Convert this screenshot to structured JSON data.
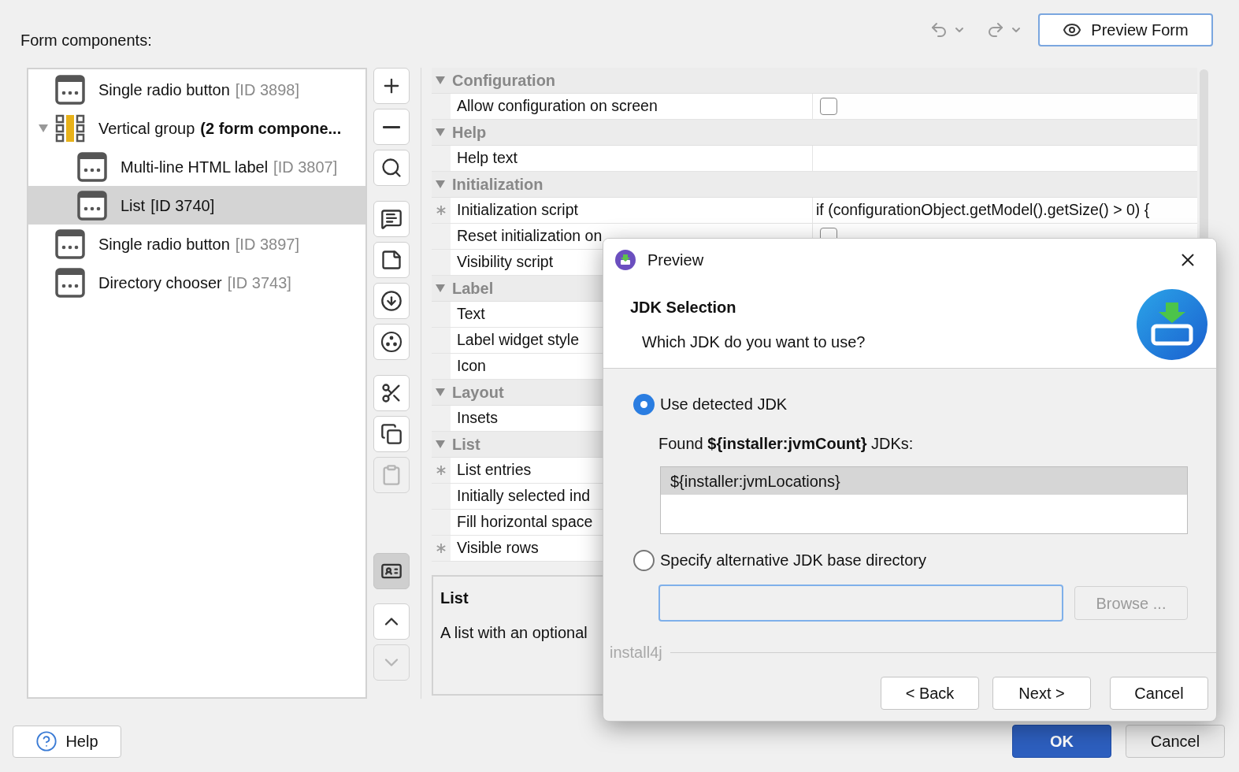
{
  "header": {
    "title": "Form components:",
    "preview_button": "Preview Form"
  },
  "tree": [
    {
      "kind": "component",
      "label": "Single radio button",
      "id": "[ID 3898]",
      "selected": false
    },
    {
      "kind": "group",
      "label": "Vertical group",
      "detail": "(2 form compone...",
      "expanded": true,
      "selected": false,
      "children": [
        {
          "kind": "component",
          "label": "Multi-line HTML label",
          "id": "[ID 3807]",
          "selected": false
        },
        {
          "kind": "component",
          "label": "List",
          "id": "[ID 3740]",
          "selected": true
        }
      ]
    },
    {
      "kind": "component",
      "label": "Single radio button",
      "id": "[ID 3897]",
      "selected": false
    },
    {
      "kind": "component",
      "label": "Directory chooser",
      "id": "[ID 3743]",
      "selected": false
    }
  ],
  "side_buttons": [
    {
      "kind": "add",
      "disabled": false,
      "pressed": false
    },
    {
      "kind": "remove",
      "disabled": false,
      "pressed": false
    },
    {
      "kind": "search",
      "disabled": false,
      "pressed": false
    },
    {
      "kind": "message",
      "disabled": false,
      "pressed": false
    },
    {
      "kind": "note",
      "disabled": false,
      "pressed": false
    },
    {
      "kind": "download",
      "disabled": false,
      "pressed": false
    },
    {
      "kind": "dots",
      "disabled": false,
      "pressed": false
    },
    {
      "kind": "cut",
      "disabled": false,
      "pressed": false
    },
    {
      "kind": "copy",
      "disabled": false,
      "pressed": false
    },
    {
      "kind": "paste",
      "disabled": true,
      "pressed": false
    },
    {
      "kind": "card",
      "disabled": false,
      "pressed": true
    },
    {
      "kind": "up",
      "disabled": false,
      "pressed": false
    },
    {
      "kind": "down",
      "disabled": true,
      "pressed": false
    }
  ],
  "properties": [
    {
      "name": "Configuration",
      "expanded": true,
      "rows": [
        {
          "name": "Allow configuration on screen",
          "starred": false,
          "kind": "checkbox",
          "checked": false
        }
      ]
    },
    {
      "name": "Help",
      "expanded": true,
      "rows": [
        {
          "name": "Help text",
          "starred": false,
          "kind": "empty"
        }
      ]
    },
    {
      "name": "Initialization",
      "expanded": true,
      "rows": [
        {
          "name": "Initialization script",
          "starred": true,
          "kind": "text",
          "value": "if (configurationObject.getModel().getSize() > 0) {"
        },
        {
          "name": "Reset initialization on",
          "starred": false,
          "kind": "checkbox",
          "checked": false
        },
        {
          "name": "Visibility script",
          "starred": false,
          "kind": "text"
        }
      ]
    },
    {
      "name": "Label",
      "expanded": true,
      "rows": [
        {
          "name": "Text",
          "starred": false,
          "kind": "text"
        },
        {
          "name": "Label widget style",
          "starred": false,
          "kind": "text"
        },
        {
          "name": "Icon",
          "starred": false,
          "kind": "text"
        }
      ]
    },
    {
      "name": "Layout",
      "expanded": true,
      "rows": [
        {
          "name": "Insets",
          "starred": false,
          "kind": "text"
        }
      ]
    },
    {
      "name": "List",
      "expanded": true,
      "rows": [
        {
          "name": "List entries",
          "starred": true,
          "kind": "text"
        },
        {
          "name": "Initially selected ind",
          "starred": false,
          "kind": "text"
        },
        {
          "name": "Fill horizontal space",
          "starred": false,
          "kind": "text"
        },
        {
          "name": "Visible rows",
          "starred": true,
          "kind": "text"
        }
      ]
    }
  ],
  "description": {
    "title": "List",
    "text": "A list with an optional"
  },
  "footer": {
    "help_button": "Help",
    "ok_button": "OK",
    "cancel_button": "Cancel"
  },
  "dialog": {
    "title": "Preview",
    "heading": "JDK Selection",
    "subtitle": "Which JDK do you want to use?",
    "options": [
      {
        "label": "Use detected JDK",
        "selected": true
      },
      {
        "label": "Specify alternative JDK base directory",
        "selected": false
      }
    ],
    "found_text": "Found **${installer:jvmCount}** JDKs:",
    "jdk_list": [
      {
        "label": "${installer:jvmLocations}",
        "selected": true
      }
    ],
    "browse_button": {
      "label": "Browse ...",
      "disabled": true
    },
    "brand": "install4j",
    "buttons": [
      "< Back",
      "Next >",
      "Cancel"
    ]
  }
}
